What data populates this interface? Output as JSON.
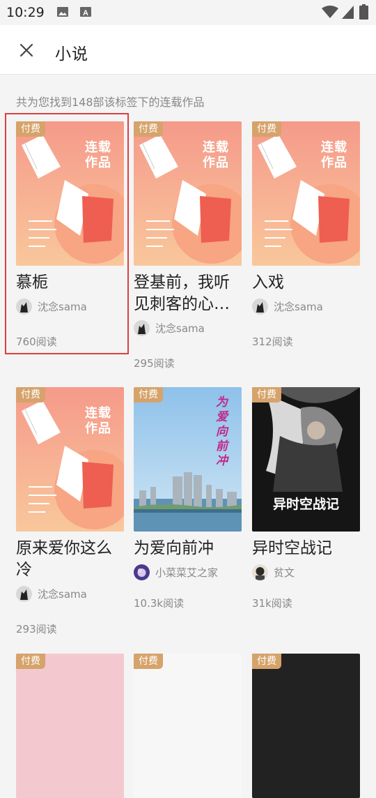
{
  "status": {
    "time": "10:29"
  },
  "header": {
    "title": "小说"
  },
  "result_text": "共为您找到148部该标签下的连载作品",
  "cover_label": [
    "连载",
    "作品"
  ],
  "books": [
    {
      "badge": "付费",
      "title": "慕栀",
      "author": "沈念sama",
      "reads": "760阅读"
    },
    {
      "badge": "付费",
      "title": "登基前，我听见刺客的心…",
      "author": "沈念sama",
      "reads": "295阅读"
    },
    {
      "badge": "付费",
      "title": "入戏",
      "author": "沈念sama",
      "reads": "312阅读"
    },
    {
      "badge": "付费",
      "title": "原来爱你这么冷",
      "author": "沈念sama",
      "reads": "293阅读"
    },
    {
      "badge": "付费",
      "title": "为爱向前冲",
      "author": "小菜菜艾之家",
      "reads": "10.3k阅读",
      "cover_text": "为爱向前冲"
    },
    {
      "badge": "付费",
      "title": "异时空战记",
      "author": "贫文",
      "reads": "31k阅读",
      "cover_text": "异时空战记"
    },
    {
      "badge": "付费"
    },
    {
      "badge": "付费"
    },
    {
      "badge": "付费"
    }
  ],
  "colors": {
    "badge": "#d6a36b",
    "selection": "#d9403f",
    "cover_gradient_top": "#f59a8a",
    "cover_gradient_bottom": "#f9c79c"
  }
}
